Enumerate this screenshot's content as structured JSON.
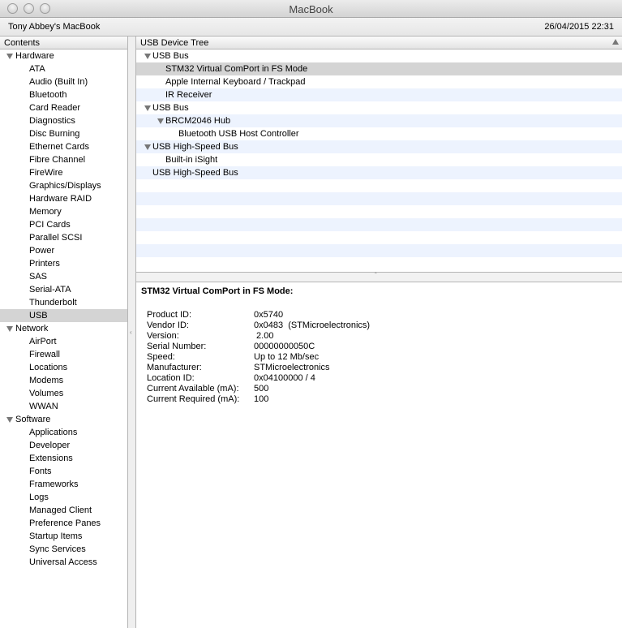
{
  "window": {
    "title": "MacBook"
  },
  "infobar": {
    "machine": "Tony Abbey's MacBook",
    "datetime": "26/04/2015 22:31"
  },
  "sidebar": {
    "header": "Contents",
    "groups": [
      {
        "label": "Hardware",
        "items": [
          "ATA",
          "Audio (Built In)",
          "Bluetooth",
          "Card Reader",
          "Diagnostics",
          "Disc Burning",
          "Ethernet Cards",
          "Fibre Channel",
          "FireWire",
          "Graphics/Displays",
          "Hardware RAID",
          "Memory",
          "PCI Cards",
          "Parallel SCSI",
          "Power",
          "Printers",
          "SAS",
          "Serial-ATA",
          "Thunderbolt",
          "USB"
        ]
      },
      {
        "label": "Network",
        "items": [
          "AirPort",
          "Firewall",
          "Locations",
          "Modems",
          "Volumes",
          "WWAN"
        ]
      },
      {
        "label": "Software",
        "items": [
          "Applications",
          "Developer",
          "Extensions",
          "Fonts",
          "Frameworks",
          "Logs",
          "Managed Client",
          "Preference Panes",
          "Startup Items",
          "Sync Services",
          "Universal Access"
        ]
      }
    ],
    "selected": "USB"
  },
  "usb_tree": {
    "header": "USB Device Tree",
    "rows": [
      {
        "label": "USB Bus",
        "indent": 0,
        "expandable": true
      },
      {
        "label": "STM32 Virtual ComPort in FS Mode",
        "indent": 2,
        "expandable": false,
        "selected": true
      },
      {
        "label": "Apple Internal Keyboard / Trackpad",
        "indent": 2,
        "expandable": false
      },
      {
        "label": "IR Receiver",
        "indent": 2,
        "expandable": false
      },
      {
        "label": "USB Bus",
        "indent": 0,
        "expandable": true
      },
      {
        "label": "BRCM2046 Hub",
        "indent": 1,
        "expandable": true
      },
      {
        "label": "Bluetooth USB Host Controller",
        "indent": 3,
        "expandable": false
      },
      {
        "label": "USB High-Speed Bus",
        "indent": 0,
        "expandable": true
      },
      {
        "label": "Built-in iSight",
        "indent": 2,
        "expandable": false
      },
      {
        "label": "USB High-Speed Bus",
        "indent": 0,
        "expandable": false,
        "noTriangle": true
      }
    ]
  },
  "details": {
    "title": "STM32 Virtual ComPort in FS Mode:",
    "fields": [
      {
        "key": "Product ID:",
        "value": "0x5740"
      },
      {
        "key": "Vendor ID:",
        "value": "0x0483  (STMicroelectronics)"
      },
      {
        "key": "Version:",
        "value": " 2.00"
      },
      {
        "key": "Serial Number:",
        "value": "00000000050C"
      },
      {
        "key": "Speed:",
        "value": "Up to 12 Mb/sec"
      },
      {
        "key": "Manufacturer:",
        "value": "STMicroelectronics"
      },
      {
        "key": "Location ID:",
        "value": "0x04100000 / 4"
      },
      {
        "key": "Current Available (mA):",
        "value": "500"
      },
      {
        "key": "Current Required (mA):",
        "value": "100"
      }
    ]
  }
}
